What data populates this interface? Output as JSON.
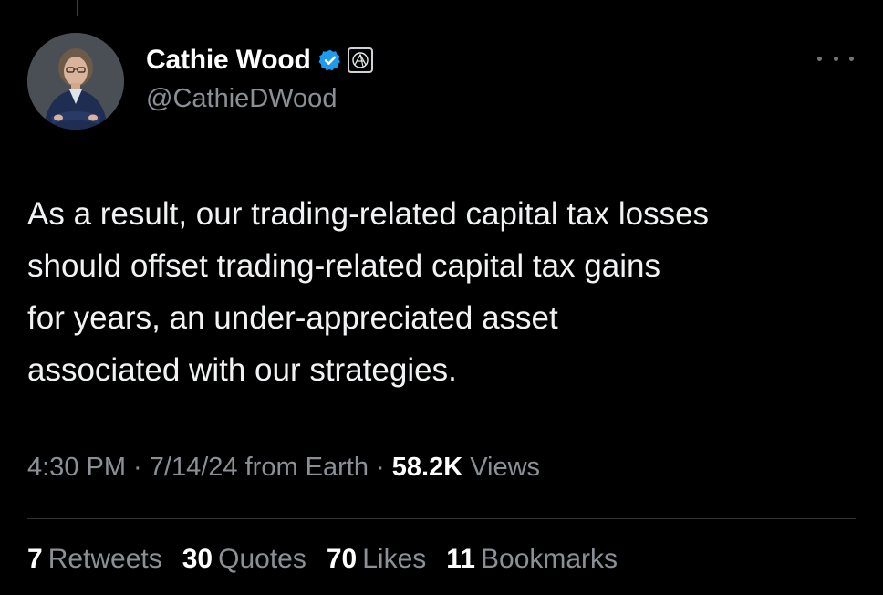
{
  "tweet": {
    "author": {
      "display_name": "Cathie Wood",
      "handle": "@CathieDWood",
      "verified_icon": "verified-badge-icon",
      "affiliate_icon": "ark-logo-icon",
      "verified_color": "#1d9bf0"
    },
    "more_icon": "more-options-icon",
    "text_lines": [
      "As a result, our trading-related capital tax losses",
      "should offset trading-related capital tax gains",
      "for years, an under-appreciated asset",
      "associated with our strategies."
    ],
    "meta": {
      "time": "4:30 PM",
      "sep1": " · ",
      "date": "7/14/24",
      "source": " from Earth",
      "sep2": " · ",
      "views_count": "58.2K",
      "views_label": " Views"
    },
    "stats": {
      "retweets": {
        "count": "7",
        "label": "Retweets"
      },
      "quotes": {
        "count": "30",
        "label": "Quotes"
      },
      "likes": {
        "count": "70",
        "label": "Likes"
      },
      "bookmarks": {
        "count": "11",
        "label": "Bookmarks"
      }
    }
  },
  "colors": {
    "background": "#000000",
    "primary_text": "#e7e9ea",
    "secondary_text": "#8b9096",
    "divider": "#2f3336"
  }
}
